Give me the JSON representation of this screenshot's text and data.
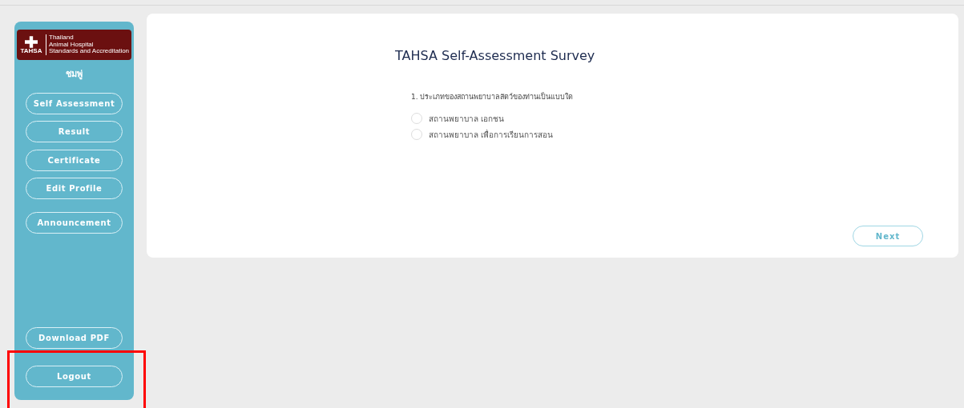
{
  "sidebar": {
    "logo": {
      "badge": "TAHSA",
      "lines": [
        "Thailand",
        "Animal Hospital",
        "Standards and Accreditation"
      ]
    },
    "username": "ชมพู่",
    "menu_top": [
      "Self Assessment",
      "Result",
      "Certificate",
      "Edit Profile",
      "Announcement"
    ],
    "menu_bottom": [
      "Download PDF",
      "Logout"
    ]
  },
  "survey": {
    "title": "TAHSA Self-Assessment Survey",
    "question": "1. ประเภทของสถานพยาบาลสัตว์ของท่านเป็นแบบใด",
    "options": [
      {
        "label": "สถานพยาบาล เอกชน",
        "selected": false
      },
      {
        "label": "สถานพยาบาล เพื่อการเรียนการสอน",
        "selected": false
      }
    ],
    "next_button": "Next"
  },
  "annotation": {
    "kind": "highlight-box"
  }
}
